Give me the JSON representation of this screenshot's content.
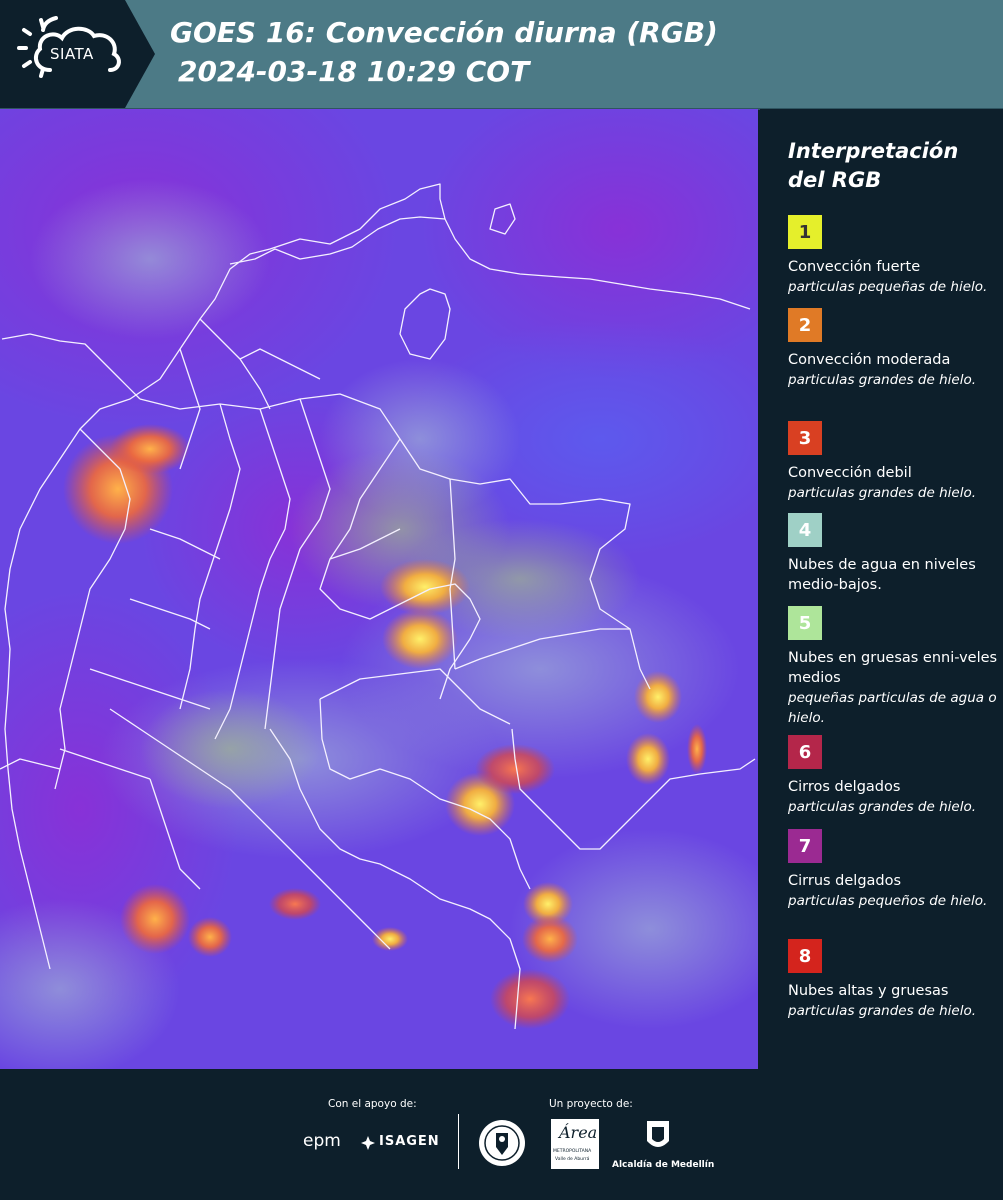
{
  "header": {
    "logo_text": "SIATA",
    "title_line1": "GOES 16: Convección diurna (RGB)",
    "title_line2": "2024-03-18 10:29 COT"
  },
  "legend": {
    "title_line1": "Interpretación",
    "title_line2": "del RGB",
    "items": [
      {
        "number": "1",
        "color": "#e5ef2b",
        "number_color": "#333333",
        "title": "Convección fuerte",
        "subtitle": "particulas pequeñas de hielo."
      },
      {
        "number": "2",
        "color": "#e07a26",
        "number_color": "#ffffff",
        "title": "Convección moderada",
        "subtitle": "particulas grandes de hielo."
      },
      {
        "number": "3",
        "color": "#d94022",
        "number_color": "#ffffff",
        "title": "Convección debil",
        "subtitle": "particulas grandes de hielo."
      },
      {
        "number": "4",
        "color": "#9fd0c6",
        "number_color": "#ffffff",
        "title": "Nubes de agua en niveles medio-bajos.",
        "subtitle": ""
      },
      {
        "number": "5",
        "color": "#aee59a",
        "number_color": "#ffffff",
        "title": "Nubes en gruesas enni-veles medios",
        "subtitle": "pequeñas particulas de agua o hielo."
      },
      {
        "number": "6",
        "color": "#b4264a",
        "number_color": "#ffffff",
        "title": "Cirros delgados",
        "subtitle": "particulas grandes de hielo."
      },
      {
        "number": "7",
        "color": "#9b2a92",
        "number_color": "#ffffff",
        "title": "Cirrus delgados",
        "subtitle": "particulas pequeños de hielo."
      },
      {
        "number": "8",
        "color": "#d4241d",
        "number_color": "#ffffff",
        "title": "Nubes altas y gruesas",
        "subtitle": "particulas grandes de hielo."
      }
    ]
  },
  "footer": {
    "support_label": "Con el apoyo de:",
    "project_label": "Un proyecto de:",
    "sponsor_epm": "epm",
    "sponsor_isagen": "ISAGEN",
    "area_name": "Área",
    "area_sub1": "METROPOLITANA",
    "area_sub2": "Valle de Aburrá",
    "alcaldia": "Alcaldía de Medellín"
  },
  "colors": {
    "header_bg": "#4c7a86",
    "panel_bg": "#0d1f2b",
    "map_base": "#6a3fe0"
  }
}
